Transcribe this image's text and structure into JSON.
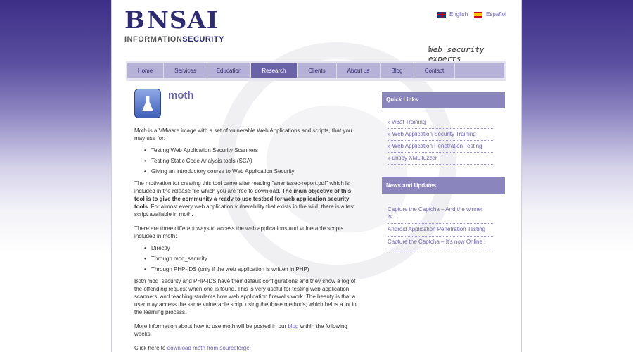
{
  "logo": {
    "main_left": "B",
    "main_right": "NSAI",
    "sub_left": "INFORMATION",
    "sub_right": "SECURITY"
  },
  "languages": [
    {
      "label": "English",
      "flag": "uk-flag-icon"
    },
    {
      "label": "Español",
      "flag": "spain-flag-icon"
    }
  ],
  "tagline": "Web security experts",
  "nav": {
    "items": [
      {
        "label": "Home"
      },
      {
        "label": "Services"
      },
      {
        "label": "Education"
      },
      {
        "label": "Research",
        "active": true
      },
      {
        "label": "Clients"
      },
      {
        "label": "About us"
      },
      {
        "label": "Blog"
      },
      {
        "label": "Contact"
      }
    ]
  },
  "article": {
    "title": "moth",
    "intro": "Moth is a VMware image with a set of vulnerable Web Applications and scripts, that you may use for:",
    "uses": [
      "Testing Web Application Security Scanners",
      "Testing Static Code Analysis tools (SCA)",
      "Giving an introductory course to Web Application Security"
    ],
    "motivation_1": "The motivation for creating this tool came after reading \"anantasec-report.pdf\" which is included in the release file which you are free to download.",
    "motivation_bold": "The main objective of this tool is to give the community a ready to use testbed for web application security tools",
    "motivation_2": ". For almost every web application vulnerability that exists in the wild, there is a test script available in moth.",
    "access_intro": "There are three different ways to access the web applications and vulnerable scripts included in moth:",
    "access": [
      "Directly",
      "Through mod_security",
      "Through PHP-IDS (only if the web application is written in PHP)"
    ],
    "both": "Both mod_security and PHP-IDS have their default configurations and they show a log of the offending request when one is found. This is very useful for testing web application scanners, and teaching students how web application firewalls work. The beauty is that a user may access the same vulnerable script using the three methods; which helps a lot in the learning process.",
    "more_1": "More information about how to use moth will be posted in our ",
    "more_link": "blog",
    "more_2": " within the following weeks.",
    "click_1": "Click here to ",
    "click_link": "download moth from sourceforge",
    "click_2": "."
  },
  "sidebar": {
    "quick_links_title": "Quick Links",
    "quick_links": [
      "» w3af Training",
      "» Web Application Security Training",
      "» Web Application Penetration Testing",
      "» untidy XML fuzzer"
    ],
    "news_title": "News and Updates",
    "news": [
      "Capture the Captcha – And the winner is…",
      "Android Application Penetration Testing",
      "Capture the Captcha – It's now Online !"
    ]
  },
  "colors": {
    "accent": "#6b63a8",
    "nav_bg": "#b6b1d6",
    "nav_active": "#6b63a8",
    "sidebar_header": "#8b85be",
    "logo": "#2e2b6e"
  }
}
